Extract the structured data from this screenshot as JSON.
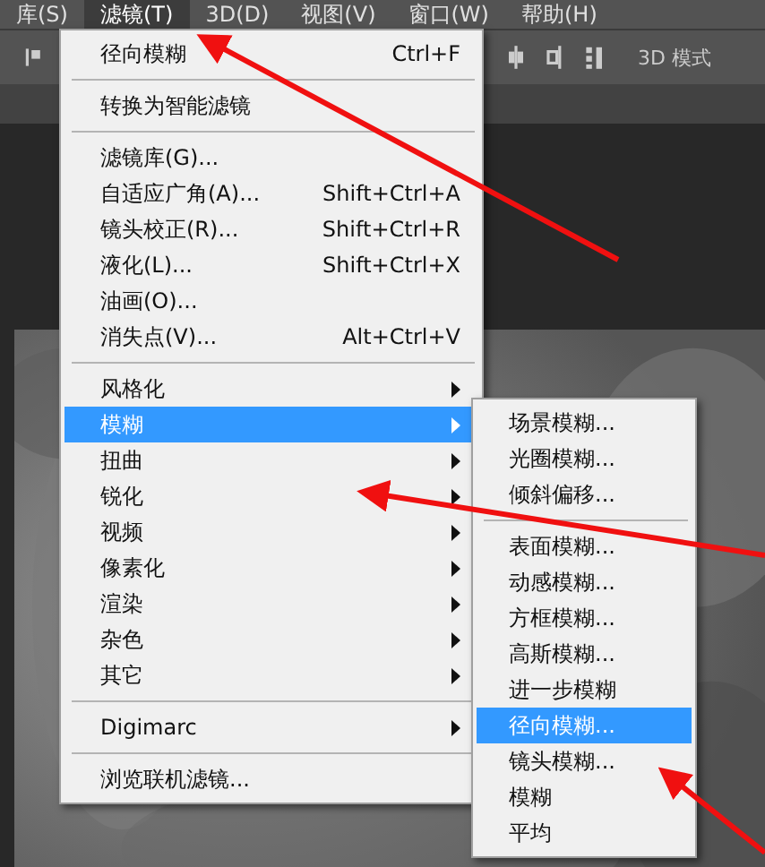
{
  "menu_bar": [
    {
      "label": "库(S)",
      "selected": false
    },
    {
      "label": "滤镜(T)",
      "selected": true
    },
    {
      "label": "3D(D)",
      "selected": false
    },
    {
      "label": "视图(V)",
      "selected": false
    },
    {
      "label": "窗口(W)",
      "selected": false
    },
    {
      "label": "帮助(H)",
      "selected": false
    }
  ],
  "toolbar": {
    "mode_label": "3D 模式"
  },
  "filter_menu": [
    {
      "kind": "item",
      "label": "径向模糊",
      "shortcut": "Ctrl+F",
      "submenu": false,
      "selected": false
    },
    {
      "kind": "separator"
    },
    {
      "kind": "item",
      "label": "转换为智能滤镜",
      "submenu": false,
      "selected": false
    },
    {
      "kind": "separator"
    },
    {
      "kind": "item",
      "label": "滤镜库(G)...",
      "submenu": false,
      "selected": false
    },
    {
      "kind": "item",
      "label": "自适应广角(A)...",
      "shortcut": "Shift+Ctrl+A",
      "submenu": false,
      "selected": false
    },
    {
      "kind": "item",
      "label": "镜头校正(R)...",
      "shortcut": "Shift+Ctrl+R",
      "submenu": false,
      "selected": false
    },
    {
      "kind": "item",
      "label": "液化(L)...",
      "shortcut": "Shift+Ctrl+X",
      "submenu": false,
      "selected": false
    },
    {
      "kind": "item",
      "label": "油画(O)...",
      "submenu": false,
      "selected": false
    },
    {
      "kind": "item",
      "label": "消失点(V)...",
      "shortcut": "Alt+Ctrl+V",
      "submenu": false,
      "selected": false
    },
    {
      "kind": "separator"
    },
    {
      "kind": "item",
      "label": "风格化",
      "submenu": true,
      "selected": false
    },
    {
      "kind": "item",
      "label": "模糊",
      "submenu": true,
      "selected": true
    },
    {
      "kind": "item",
      "label": "扭曲",
      "submenu": true,
      "selected": false
    },
    {
      "kind": "item",
      "label": "锐化",
      "submenu": true,
      "selected": false
    },
    {
      "kind": "item",
      "label": "视频",
      "submenu": true,
      "selected": false
    },
    {
      "kind": "item",
      "label": "像素化",
      "submenu": true,
      "selected": false
    },
    {
      "kind": "item",
      "label": "渲染",
      "submenu": true,
      "selected": false
    },
    {
      "kind": "item",
      "label": "杂色",
      "submenu": true,
      "selected": false
    },
    {
      "kind": "item",
      "label": "其它",
      "submenu": true,
      "selected": false
    },
    {
      "kind": "separator"
    },
    {
      "kind": "item",
      "label": "Digimarc",
      "submenu": true,
      "selected": false
    },
    {
      "kind": "separator"
    },
    {
      "kind": "item",
      "label": "浏览联机滤镜...",
      "submenu": false,
      "selected": false
    }
  ],
  "blur_submenu": [
    {
      "kind": "item",
      "label": "场景模糊...",
      "selected": false
    },
    {
      "kind": "item",
      "label": "光圈模糊...",
      "selected": false
    },
    {
      "kind": "item",
      "label": "倾斜偏移...",
      "selected": false
    },
    {
      "kind": "separator"
    },
    {
      "kind": "item",
      "label": "表面模糊...",
      "selected": false
    },
    {
      "kind": "item",
      "label": "动感模糊...",
      "selected": false
    },
    {
      "kind": "item",
      "label": "方框模糊...",
      "selected": false
    },
    {
      "kind": "item",
      "label": "高斯模糊...",
      "selected": false
    },
    {
      "kind": "item",
      "label": "进一步模糊",
      "selected": false
    },
    {
      "kind": "item",
      "label": "径向模糊...",
      "selected": true
    },
    {
      "kind": "item",
      "label": "镜头模糊...",
      "selected": false
    },
    {
      "kind": "item",
      "label": "模糊",
      "selected": false
    },
    {
      "kind": "item",
      "label": "平均",
      "selected": false
    }
  ]
}
